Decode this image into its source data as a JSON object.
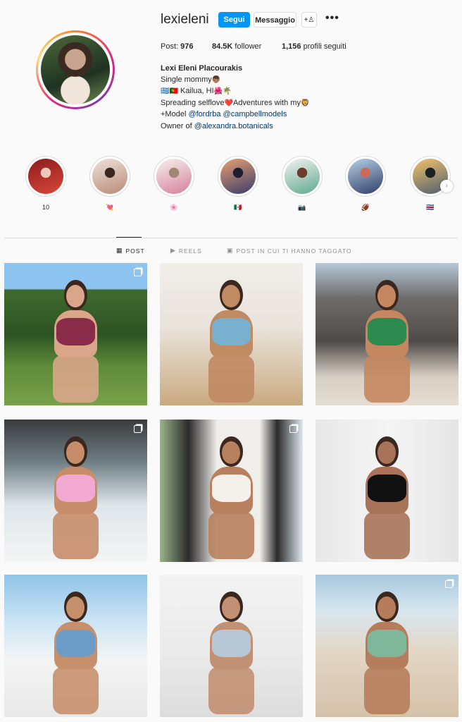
{
  "profile": {
    "username": "lexieleni",
    "follow_label": "Segui",
    "message_label": "Messaggio",
    "add_user_icon": "+♙",
    "more_icon": "•••",
    "stats": {
      "posts_label": "Post:",
      "posts_value": "976",
      "followers_value": "84.5K",
      "followers_label": "follower",
      "following_value": "1,156",
      "following_label": "profili seguiti"
    },
    "full_name": "Lexi Eleni Placourakis",
    "bio": {
      "line1_text": "Single mommy",
      "line1_emoji": "👦🏽",
      "line2_flags": "🇬🇷🇵🇹",
      "line2_text": " Kailua, HI",
      "line2_emoji": "🌺🌴",
      "line3_text": "Spreading selflove",
      "line3_emoji": "❤️",
      "line3_text2": "Adventures with my",
      "line3_emoji2": "🦁",
      "line4_prefix": "+Model ",
      "line4_link1": "@fordrba",
      "line4_link2": "@campbellmodels",
      "line5_prefix": "Owner of ",
      "line5_link": "@alexandra.botanicals"
    }
  },
  "highlights": [
    {
      "label": "10",
      "colors": [
        "#8a1c1c",
        "#d9483b",
        "#f0c7b8"
      ]
    },
    {
      "label": "💘",
      "colors": [
        "#efe2dc",
        "#b88a76",
        "#3a2620"
      ]
    },
    {
      "label": "🌸",
      "colors": [
        "#f6f1ee",
        "#d67f9c",
        "#a08875"
      ]
    },
    {
      "label": "🇲🇽",
      "colors": [
        "#e8a070",
        "#3b3d6b",
        "#1e1f2e"
      ]
    },
    {
      "label": "📷",
      "colors": [
        "#f3f3f3",
        "#5fa98c",
        "#6b3d2a"
      ]
    },
    {
      "label": "🏈",
      "colors": [
        "#b7d0e4",
        "#2f3f6a",
        "#c96a5a"
      ]
    },
    {
      "label": "🇨🇷",
      "colors": [
        "#f4c26b",
        "#4e5f6e",
        "#1c2224"
      ]
    }
  ],
  "tabs": [
    {
      "icon": "▦",
      "label": "POST"
    },
    {
      "icon": "▶",
      "label": "REELS"
    },
    {
      "icon": "▣",
      "label": "POST IN CUI TI HANNO TAGGATO"
    }
  ],
  "grid": [
    {
      "bg": "linear-gradient(180deg,#8ec5f0 0%,#8ec5f0 18%,#3f6b2f 19%,#2d5223 50%,#5e8b3a 72%,#7aa14a 100%)",
      "figure": "#d9a689",
      "accent": "#8b2b4a",
      "multi": true
    },
    {
      "bg": "linear-gradient(180deg,#f1eee9 0%,#e9e3db 45%,#d9c5ab 75%,#c9a97e 100%)",
      "figure": "#c08a63",
      "accent": "#7ab0cf",
      "multi": false
    },
    {
      "bg": "linear-gradient(180deg,#b4c8d9 0%,#6e6b68 25%,#4f4b48 55%,#d8cfc4 80%,#e6ddd2 100%)",
      "figure": "#c4875f",
      "accent": "#2d8a4f",
      "multi": false
    },
    {
      "bg": "linear-gradient(180deg,#3a3b3c 0%,#6f7f85 30%,#dfe6ea 60%,#f4f4f4 100%)",
      "figure": "#c78d6a",
      "accent": "#f2a9d1",
      "multi": true
    },
    {
      "bg": "linear-gradient(90deg,#9ab58a 0%,#2b2b2b 20%,#f0eeeb 40%,#f0eeeb 70%,#2b2b2b 82%,#dfe7ee 100%)",
      "figure": "#b7805e",
      "accent": "#f4f1eb",
      "multi": true
    },
    {
      "bg": "linear-gradient(90deg,#e7e7e7 0%,#f5f5f5 50%,#e5e5e5 100%)",
      "figure": "#a9735a",
      "accent": "#111111",
      "multi": false
    },
    {
      "bg": "linear-gradient(180deg,#8fc4e8 0%,#cfe6f5 35%,#f4f4f4 60%,#e8e8e8 100%)",
      "figure": "#c6906d",
      "accent": "#6b9bc7",
      "multi": false
    },
    {
      "bg": "linear-gradient(180deg,#f3f3f3 0%,#e9e9e9 60%,#dcdcdc 100%)",
      "figure": "#c29072",
      "accent": "#b8c7d6",
      "multi": false
    },
    {
      "bg": "linear-gradient(180deg,#a7c8df 0%,#d7e6ef 25%,#e3d6c5 55%,#d4c1a8 100%)",
      "figure": "#b67d5c",
      "accent": "#7fb79a",
      "multi": true
    }
  ]
}
